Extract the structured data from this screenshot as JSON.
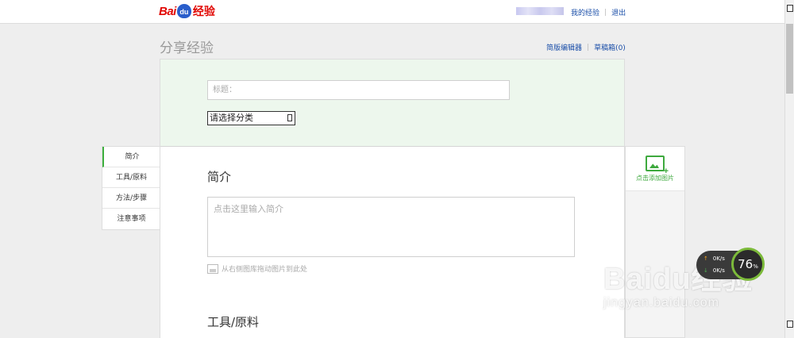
{
  "header": {
    "logo_text": "Bai",
    "logo_paw": "du",
    "logo_suffix": "经验",
    "my_experience": "我的经验",
    "logout": "退出"
  },
  "page": {
    "title": "分享经验",
    "simple_editor": "简版编辑器",
    "drafts": "草稿箱(0)"
  },
  "form": {
    "title_placeholder": "标题：",
    "category_select": "请选择分类",
    "intro_heading": "简介",
    "intro_placeholder": "点击这里输入简介",
    "drag_hint": "从右侧图库拖动图片到此处",
    "tools_heading": "工具/原料"
  },
  "side_tabs": [
    {
      "label": "简介",
      "active": true
    },
    {
      "label": "工具/原料",
      "active": false
    },
    {
      "label": "方法/步骤",
      "active": false
    },
    {
      "label": "注意事项",
      "active": false
    }
  ],
  "image_panel": {
    "add_label": "点击添加图片",
    "icon": "add-image-icon"
  },
  "speed_widget": {
    "up": "0K/s",
    "down": "0K/s",
    "percent": "76",
    "unit": "%"
  },
  "watermark": {
    "brand": "Baidu经验",
    "url": "jingyan.baidu.com"
  },
  "colors": {
    "brand_red": "#e10602",
    "brand_blue": "#2a5ecb",
    "accent_green": "#3eaf3e",
    "link_blue": "#1a4ea8",
    "panel_green": "#edf7ed"
  }
}
